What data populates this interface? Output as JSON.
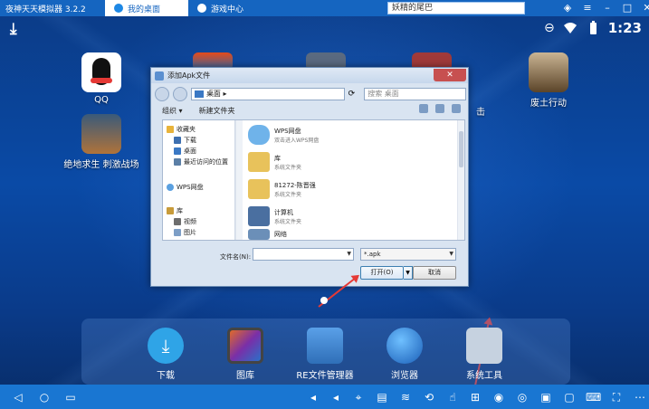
{
  "window": {
    "title": "夜神天天模拟器 3.2.2"
  },
  "tabs": [
    {
      "label": "我的桌面",
      "active": true
    },
    {
      "label": "游戏中心",
      "active": false
    }
  ],
  "top_search": {
    "value": "妖精的尾巴"
  },
  "status_bar": {
    "time": "1:23"
  },
  "desktop_apps": [
    {
      "label": "QQ",
      "color": "#111111"
    },
    {
      "label": "绝地求生 刺激战场",
      "color": "#b0733a"
    },
    {
      "label": "废土行动",
      "color": "#8a6a43"
    },
    {
      "label": "击",
      "color": "#333333"
    }
  ],
  "dock_apps": [
    {
      "label": "下载",
      "color": "#2fa4e7"
    },
    {
      "label": "图库",
      "color": "#d9a32e"
    },
    {
      "label": "RE文件管理器",
      "color": "#3f7fcf"
    },
    {
      "label": "浏览器",
      "color": "#2a7fd1"
    },
    {
      "label": "系统工具",
      "color": "#9fb3c9"
    }
  ],
  "dialog": {
    "title": "添加Apk文件",
    "address": "桌面",
    "address_arrow": "▸",
    "search_placeholder": "搜索 桌面",
    "toolbar": {
      "organize": "组织 ▾",
      "new_folder": "新建文件夹"
    },
    "nav_items": [
      {
        "label": "收藏夹",
        "color": "#e8b33a"
      },
      {
        "label": "下载",
        "color": "#3d6fb0"
      },
      {
        "label": "桌面",
        "color": "#3a78c4"
      },
      {
        "label": "最近访问的位置",
        "color": "#5b7fa6"
      },
      {
        "label": "WPS网盘",
        "color": "#5aa0e0"
      },
      {
        "label": "库",
        "color": "#c89b3a"
      },
      {
        "label": "视频",
        "color": "#6d6d6d"
      },
      {
        "label": "图片",
        "color": "#7d9ec6"
      }
    ],
    "files": [
      {
        "name": "WPS网盘",
        "desc": "双击进入WPS网盘",
        "color": "#6fb3ea"
      },
      {
        "name": "库",
        "desc": "系统文件夹",
        "color": "#e8c25b"
      },
      {
        "name": "81272-陈晋强",
        "desc": "系统文件夹",
        "color": "#e8c25b"
      },
      {
        "name": "计算机",
        "desc": "系统文件夹",
        "color": "#4a6fa0"
      },
      {
        "name": "网络",
        "desc": "",
        "color": "#6b8fb8"
      }
    ],
    "filename_label": "文件名(N):",
    "filename_value": "",
    "filter_value": "*.apk",
    "open_button": "打开(O)",
    "cancel_button": "取消"
  },
  "colors": {
    "topbar": "#1565c0",
    "arrow": "#e53935"
  }
}
